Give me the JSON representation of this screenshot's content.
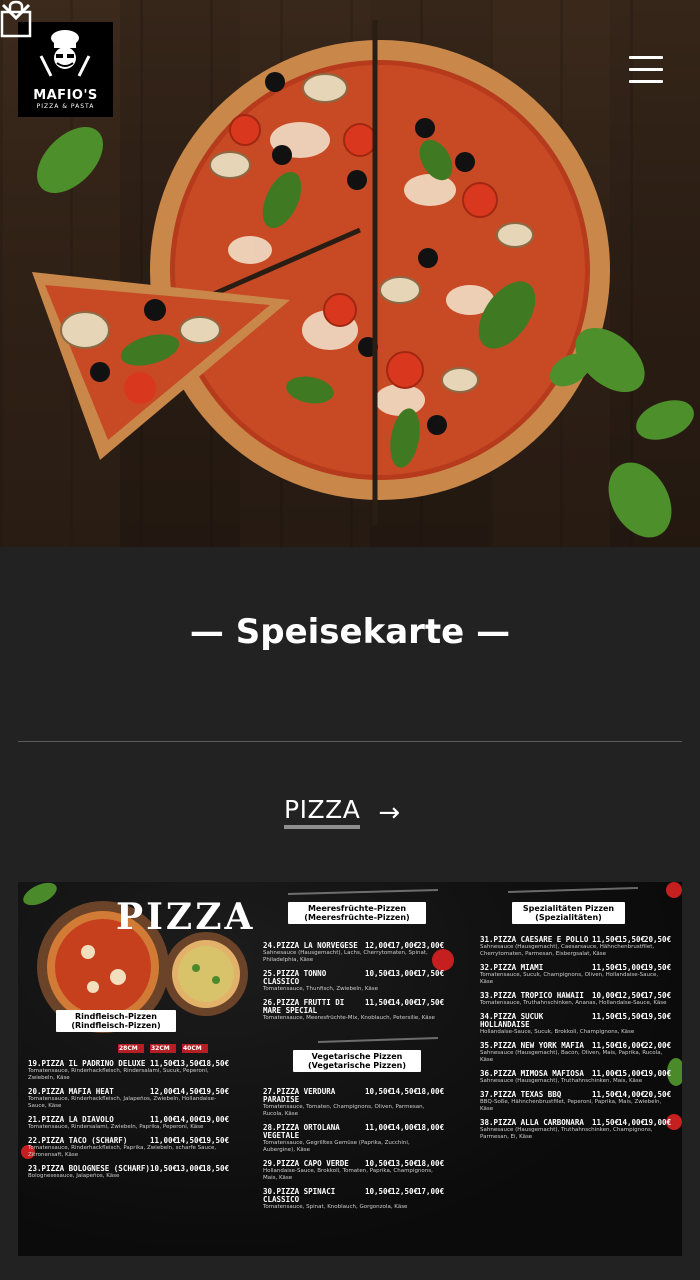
{
  "header": {
    "logo": {
      "brand": "MAFIO'S",
      "subtitle": "PIZZA & PASTA"
    },
    "cart_icon": "shopping-bag-icon",
    "menu_icon": "hamburger-menu-icon"
  },
  "hero": {
    "scroll_icon": "chevron-down-icon"
  },
  "section": {
    "title": "— Speisekarte —",
    "tab_label": "PIZZA",
    "tab_arrow": "→"
  },
  "menu_board": {
    "title": "PIZZA",
    "sizes": [
      "28CM",
      "32CM",
      "40CM"
    ],
    "categories": {
      "beef": "Rindfleisch-Pizzen\n(Rindfleisch-Pizzen)",
      "seafood": "Meeresfrüchte-Pizzen\n(Meeresfrüchte-Pizzen)",
      "veg": "Vegetarische Pizzen\n(Vegetarische Pizzen)",
      "special": "Spezialitäten Pizzen\n(Spezialitäten)"
    },
    "col1": [
      {
        "name": "19.PIZZA IL PADRINO DELUXE",
        "p": [
          "11,50€",
          "13,50€",
          "18,50€"
        ],
        "desc": "Tomatensauce, Rinderhackfleisch, Rindersalami, Sucuk, Peperoni, Zwiebeln, Käse"
      },
      {
        "name": "20.PIZZA MAFIA HEAT",
        "p": [
          "12,00€",
          "14,50€",
          "19,50€"
        ],
        "desc": "Tomatensauce, Rinderhackfleisch, Jalapeños, Zwiebeln, Hollandaise-Sauce, Käse"
      },
      {
        "name": "21.PIZZA LA DIAVOLO",
        "p": [
          "11,00€",
          "14,00€",
          "19,00€"
        ],
        "desc": "Tomatensauce, Rindersalami, Zwiebeln, Paprika, Peperoni, Käse"
      },
      {
        "name": "22.PIZZA TACO (SCHARF)",
        "p": [
          "11,00€",
          "14,50€",
          "19,50€"
        ],
        "desc": "Tomatensauce, Rinderhackfleisch, Paprika, Zwiebeln, scharfe Sauce, Zitronensaft, Käse"
      },
      {
        "name": "23.PIZZA BOLOGNESE (SCHARF)",
        "p": [
          "10,50€",
          "13,00€",
          "18,50€"
        ],
        "desc": "Bolognesesauce, Jalapeños, Käse"
      }
    ],
    "col2": [
      {
        "name": "24.PIZZA LA NORVEGESE",
        "p": [
          "12,00€",
          "17,00€",
          "23,00€"
        ],
        "desc": "Sahnesauce (Hausgemacht), Lachs, Cherrytomaten, Spinat, Philadelphia, Käse"
      },
      {
        "name": "25.PIZZA TONNO CLASSICO",
        "p": [
          "10,50€",
          "13,00€",
          "17,50€"
        ],
        "desc": "Tomatensauce, Thunfisch, Zwiebeln, Käse"
      },
      {
        "name": "26.PIZZA FRUTTI DI MARE SPECIAL",
        "p": [
          "11,50€",
          "14,00€",
          "17,50€"
        ],
        "desc": "Tomatensauce, Meeresfrüchte-Mix, Knoblauch, Petersilie, Käse"
      },
      {
        "name": "27.PIZZA VERDURA PARADISE",
        "p": [
          "10,50€",
          "14,50€",
          "18,00€"
        ],
        "desc": "Tomatensauce, Tomaten, Champignons, Oliven, Parmesan, Rucola, Käse"
      },
      {
        "name": "28.PIZZA ORTOLANA VEGETALE",
        "p": [
          "11,00€",
          "14,00€",
          "18,00€"
        ],
        "desc": "Tomatensauce, Gegrilltes Gemüse (Paprika, Zucchini, Aubergine), Käse"
      },
      {
        "name": "29.PIZZA CAPO VERDE",
        "p": [
          "10,50€",
          "13,50€",
          "18,00€"
        ],
        "desc": "Hollandaise-Sauce, Brokkoli, Tomaten, Paprika, Champignons, Mais, Käse"
      },
      {
        "name": "30.PIZZA SPINACI CLASSICO",
        "p": [
          "10,50€",
          "12,50€",
          "17,00€"
        ],
        "desc": "Tomatensauce, Spinat, Knoblauch, Gorgonzola, Käse"
      }
    ],
    "col3": [
      {
        "name": "31.PIZZA CAESARE E POLLO",
        "p": [
          "11,50€",
          "15,50€",
          "20,50€"
        ],
        "desc": "Sahnesauce (Hausgemacht), Caesarsauce, Hähnchenbrustfilet, Cherrytomaten, Parmesan, Eisbergsalat, Käse"
      },
      {
        "name": "32.PIZZA MIAMI",
        "p": [
          "11,50€",
          "15,00€",
          "19,50€"
        ],
        "desc": "Tomatensauce, Sucuk, Champignons, Oliven, Hollandaise-Sauce, Käse"
      },
      {
        "name": "33.PIZZA TROPICO HAWAII",
        "p": [
          "10,00€",
          "12,50€",
          "17,50€"
        ],
        "desc": "Tomatensauce, Truthahnschinken, Ananas, Hollandaise-Sauce, Käse"
      },
      {
        "name": "34.PIZZA SUCUK HOLLANDAISE",
        "p": [
          "11,50€",
          "15,50€",
          "19,50€"
        ],
        "desc": "Hollandaise-Sauce, Sucuk, Brokkoli, Champignons, Käse"
      },
      {
        "name": "35.PIZZA NEW YORK MAFIA",
        "p": [
          "11,50€",
          "16,00€",
          "22,00€"
        ],
        "desc": "Sahnesauce (Hausgemacht), Bacon, Oliven, Mais, Paprika, Rucola, Käse"
      },
      {
        "name": "36.PIZZA MIMOSA MAFIOSA",
        "p": [
          "11,00€",
          "15,00€",
          "19,00€"
        ],
        "desc": "Sahnesauce (Hausgemacht), Truthahnschinken, Mais, Käse"
      },
      {
        "name": "37.PIZZA TEXAS BBQ",
        "p": [
          "11,50€",
          "14,00€",
          "20,50€"
        ],
        "desc": "BBQ-Soße, Hähnchenbrustfilet, Peperoni, Paprika, Mais, Zwiebeln, Käse"
      },
      {
        "name": "38.PIZZA ALLA CARBONARA",
        "p": [
          "11,50€",
          "14,00€",
          "19,00€"
        ],
        "desc": "Sahnesauce (Hausgemacht), Truthahnschinken, Champignons, Parmesan, Ei, Käse"
      }
    ]
  }
}
